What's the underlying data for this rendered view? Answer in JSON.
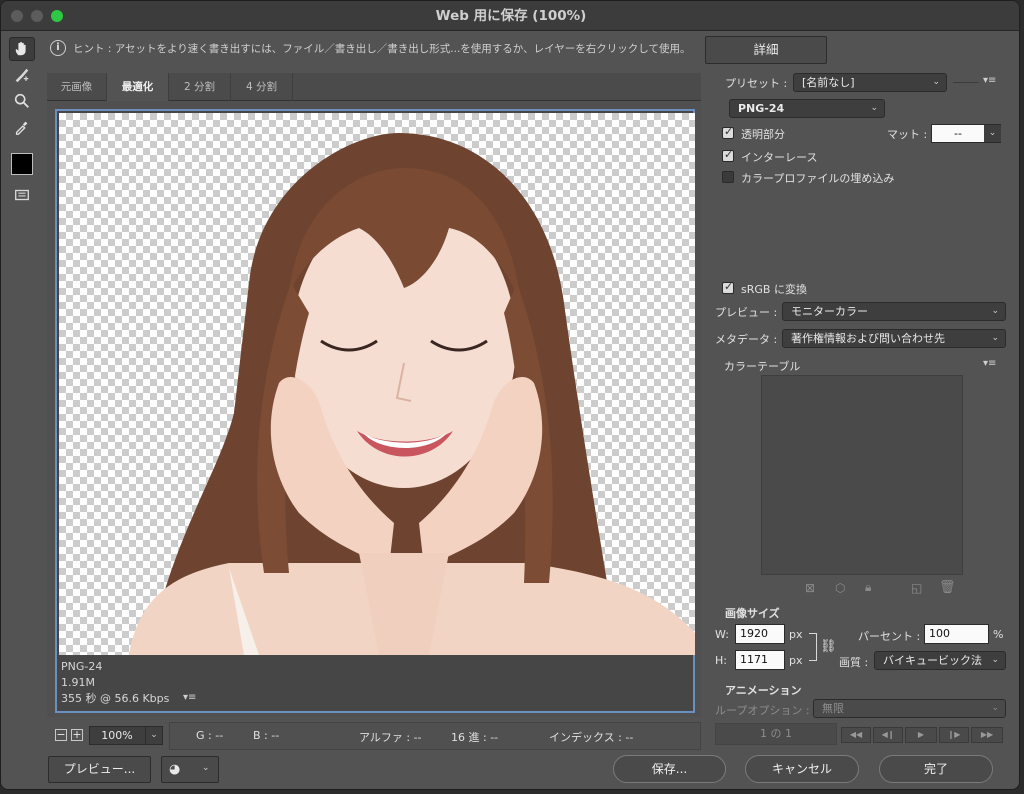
{
  "window": {
    "title": "Web 用に保存 (100%)"
  },
  "hint": {
    "text": "ヒント : アセットをより速く書き出すには、ファイル／書き出し／書き出し形式...を使用するか、レイヤーを右クリックして使用。"
  },
  "detail_button": "詳細",
  "tabs": [
    "元画像",
    "最適化",
    "2 分割",
    "4 分割"
  ],
  "image_info": {
    "format": "PNG-24",
    "size": "1.91M",
    "time": "355 秒 @ 56.6 Kbps"
  },
  "zoom": "100%",
  "status": {
    "g": "G : --",
    "b": "B : --",
    "alpha": "アルファ : --",
    "hex": "16 進 : --",
    "index": "インデックス : --"
  },
  "settings": {
    "preset_label": "プリセット :",
    "preset_value": "[名前なし]",
    "format": "PNG-24",
    "transparency": {
      "label": "透明部分",
      "checked": true
    },
    "matte_label": "マット :",
    "matte_value": "--",
    "interlace": {
      "label": "インターレース",
      "checked": true
    },
    "embed_profile": {
      "label": "カラープロファイルの埋め込み",
      "checked": false
    },
    "srgb": {
      "label": "sRGB に変換",
      "checked": true
    },
    "preview_label": "プレビュー :",
    "preview_value": "モニターカラー",
    "metadata_label": "メタデータ :",
    "metadata_value": "著作権情報および問い合わせ先",
    "color_table_label": "カラーテーブル"
  },
  "image_size": {
    "heading": "画像サイズ",
    "w_label": "W:",
    "w_value": "1920",
    "h_label": "H:",
    "h_value": "1171",
    "unit": "px",
    "percent_label": "パーセント :",
    "percent_value": "100",
    "percent_unit": "%",
    "quality_label": "画質 :",
    "quality_value": "バイキュービック法"
  },
  "animation": {
    "heading": "アニメーション",
    "loop_label": "ループオプション :",
    "loop_value": "無限",
    "frame_counter": "1 の 1"
  },
  "buttons": {
    "preview": "プレビュー...",
    "save": "保存...",
    "cancel": "キャンセル",
    "done": "完了"
  },
  "colors": {
    "accent_frame": "#6b8fc0",
    "panel": "#535353",
    "titlebar": "#3c3c3c"
  }
}
